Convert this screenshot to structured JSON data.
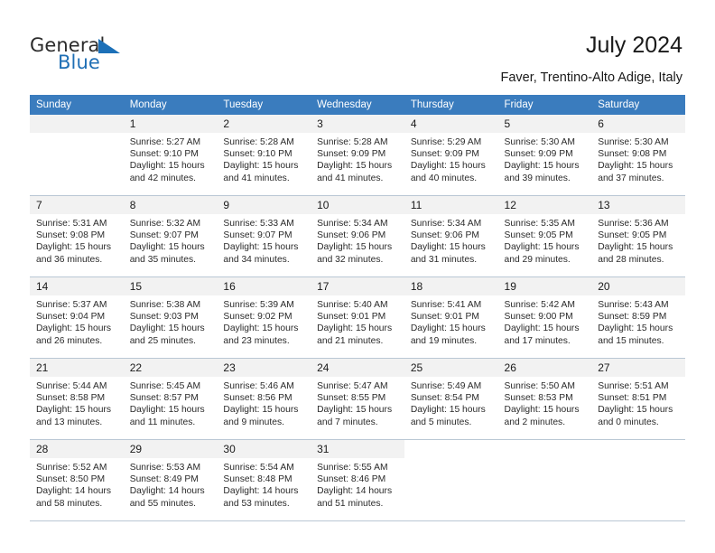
{
  "brand": {
    "name_part1": "General",
    "name_part2": "Blue",
    "accent_color": "#1c70b8"
  },
  "header": {
    "title": "July 2024",
    "subtitle": "Faver, Trentino-Alto Adige, Italy",
    "header_bg_color": "#3a7cbe"
  },
  "weekdays": [
    "Sunday",
    "Monday",
    "Tuesday",
    "Wednesday",
    "Thursday",
    "Friday",
    "Saturday"
  ],
  "weeks": [
    [
      {
        "day": "",
        "sunrise": "",
        "sunset": "",
        "daylight1": "",
        "daylight2": ""
      },
      {
        "day": "1",
        "sunrise": "Sunrise: 5:27 AM",
        "sunset": "Sunset: 9:10 PM",
        "daylight1": "Daylight: 15 hours",
        "daylight2": "and 42 minutes."
      },
      {
        "day": "2",
        "sunrise": "Sunrise: 5:28 AM",
        "sunset": "Sunset: 9:10 PM",
        "daylight1": "Daylight: 15 hours",
        "daylight2": "and 41 minutes."
      },
      {
        "day": "3",
        "sunrise": "Sunrise: 5:28 AM",
        "sunset": "Sunset: 9:09 PM",
        "daylight1": "Daylight: 15 hours",
        "daylight2": "and 41 minutes."
      },
      {
        "day": "4",
        "sunrise": "Sunrise: 5:29 AM",
        "sunset": "Sunset: 9:09 PM",
        "daylight1": "Daylight: 15 hours",
        "daylight2": "and 40 minutes."
      },
      {
        "day": "5",
        "sunrise": "Sunrise: 5:30 AM",
        "sunset": "Sunset: 9:09 PM",
        "daylight1": "Daylight: 15 hours",
        "daylight2": "and 39 minutes."
      },
      {
        "day": "6",
        "sunrise": "Sunrise: 5:30 AM",
        "sunset": "Sunset: 9:08 PM",
        "daylight1": "Daylight: 15 hours",
        "daylight2": "and 37 minutes."
      }
    ],
    [
      {
        "day": "7",
        "sunrise": "Sunrise: 5:31 AM",
        "sunset": "Sunset: 9:08 PM",
        "daylight1": "Daylight: 15 hours",
        "daylight2": "and 36 minutes."
      },
      {
        "day": "8",
        "sunrise": "Sunrise: 5:32 AM",
        "sunset": "Sunset: 9:07 PM",
        "daylight1": "Daylight: 15 hours",
        "daylight2": "and 35 minutes."
      },
      {
        "day": "9",
        "sunrise": "Sunrise: 5:33 AM",
        "sunset": "Sunset: 9:07 PM",
        "daylight1": "Daylight: 15 hours",
        "daylight2": "and 34 minutes."
      },
      {
        "day": "10",
        "sunrise": "Sunrise: 5:34 AM",
        "sunset": "Sunset: 9:06 PM",
        "daylight1": "Daylight: 15 hours",
        "daylight2": "and 32 minutes."
      },
      {
        "day": "11",
        "sunrise": "Sunrise: 5:34 AM",
        "sunset": "Sunset: 9:06 PM",
        "daylight1": "Daylight: 15 hours",
        "daylight2": "and 31 minutes."
      },
      {
        "day": "12",
        "sunrise": "Sunrise: 5:35 AM",
        "sunset": "Sunset: 9:05 PM",
        "daylight1": "Daylight: 15 hours",
        "daylight2": "and 29 minutes."
      },
      {
        "day": "13",
        "sunrise": "Sunrise: 5:36 AM",
        "sunset": "Sunset: 9:05 PM",
        "daylight1": "Daylight: 15 hours",
        "daylight2": "and 28 minutes."
      }
    ],
    [
      {
        "day": "14",
        "sunrise": "Sunrise: 5:37 AM",
        "sunset": "Sunset: 9:04 PM",
        "daylight1": "Daylight: 15 hours",
        "daylight2": "and 26 minutes."
      },
      {
        "day": "15",
        "sunrise": "Sunrise: 5:38 AM",
        "sunset": "Sunset: 9:03 PM",
        "daylight1": "Daylight: 15 hours",
        "daylight2": "and 25 minutes."
      },
      {
        "day": "16",
        "sunrise": "Sunrise: 5:39 AM",
        "sunset": "Sunset: 9:02 PM",
        "daylight1": "Daylight: 15 hours",
        "daylight2": "and 23 minutes."
      },
      {
        "day": "17",
        "sunrise": "Sunrise: 5:40 AM",
        "sunset": "Sunset: 9:01 PM",
        "daylight1": "Daylight: 15 hours",
        "daylight2": "and 21 minutes."
      },
      {
        "day": "18",
        "sunrise": "Sunrise: 5:41 AM",
        "sunset": "Sunset: 9:01 PM",
        "daylight1": "Daylight: 15 hours",
        "daylight2": "and 19 minutes."
      },
      {
        "day": "19",
        "sunrise": "Sunrise: 5:42 AM",
        "sunset": "Sunset: 9:00 PM",
        "daylight1": "Daylight: 15 hours",
        "daylight2": "and 17 minutes."
      },
      {
        "day": "20",
        "sunrise": "Sunrise: 5:43 AM",
        "sunset": "Sunset: 8:59 PM",
        "daylight1": "Daylight: 15 hours",
        "daylight2": "and 15 minutes."
      }
    ],
    [
      {
        "day": "21",
        "sunrise": "Sunrise: 5:44 AM",
        "sunset": "Sunset: 8:58 PM",
        "daylight1": "Daylight: 15 hours",
        "daylight2": "and 13 minutes."
      },
      {
        "day": "22",
        "sunrise": "Sunrise: 5:45 AM",
        "sunset": "Sunset: 8:57 PM",
        "daylight1": "Daylight: 15 hours",
        "daylight2": "and 11 minutes."
      },
      {
        "day": "23",
        "sunrise": "Sunrise: 5:46 AM",
        "sunset": "Sunset: 8:56 PM",
        "daylight1": "Daylight: 15 hours",
        "daylight2": "and 9 minutes."
      },
      {
        "day": "24",
        "sunrise": "Sunrise: 5:47 AM",
        "sunset": "Sunset: 8:55 PM",
        "daylight1": "Daylight: 15 hours",
        "daylight2": "and 7 minutes."
      },
      {
        "day": "25",
        "sunrise": "Sunrise: 5:49 AM",
        "sunset": "Sunset: 8:54 PM",
        "daylight1": "Daylight: 15 hours",
        "daylight2": "and 5 minutes."
      },
      {
        "day": "26",
        "sunrise": "Sunrise: 5:50 AM",
        "sunset": "Sunset: 8:53 PM",
        "daylight1": "Daylight: 15 hours",
        "daylight2": "and 2 minutes."
      },
      {
        "day": "27",
        "sunrise": "Sunrise: 5:51 AM",
        "sunset": "Sunset: 8:51 PM",
        "daylight1": "Daylight: 15 hours",
        "daylight2": "and 0 minutes."
      }
    ],
    [
      {
        "day": "28",
        "sunrise": "Sunrise: 5:52 AM",
        "sunset": "Sunset: 8:50 PM",
        "daylight1": "Daylight: 14 hours",
        "daylight2": "and 58 minutes."
      },
      {
        "day": "29",
        "sunrise": "Sunrise: 5:53 AM",
        "sunset": "Sunset: 8:49 PM",
        "daylight1": "Daylight: 14 hours",
        "daylight2": "and 55 minutes."
      },
      {
        "day": "30",
        "sunrise": "Sunrise: 5:54 AM",
        "sunset": "Sunset: 8:48 PM",
        "daylight1": "Daylight: 14 hours",
        "daylight2": "and 53 minutes."
      },
      {
        "day": "31",
        "sunrise": "Sunrise: 5:55 AM",
        "sunset": "Sunset: 8:46 PM",
        "daylight1": "Daylight: 14 hours",
        "daylight2": "and 51 minutes."
      },
      {
        "day": "",
        "sunrise": "",
        "sunset": "",
        "daylight1": "",
        "daylight2": ""
      },
      {
        "day": "",
        "sunrise": "",
        "sunset": "",
        "daylight1": "",
        "daylight2": ""
      },
      {
        "day": "",
        "sunrise": "",
        "sunset": "",
        "daylight1": "",
        "daylight2": ""
      }
    ]
  ]
}
